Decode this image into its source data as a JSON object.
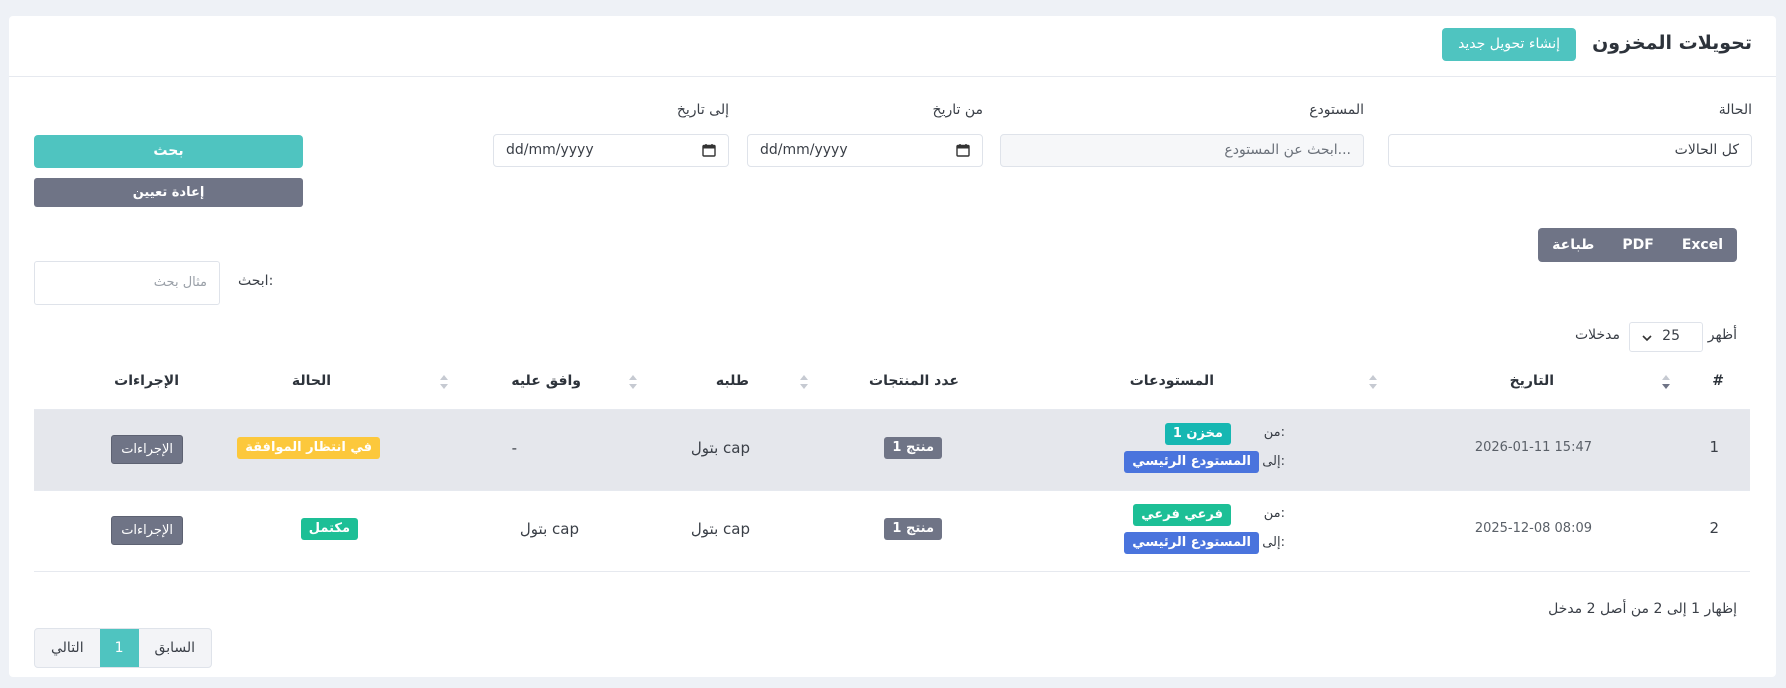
{
  "header": {
    "title": "تحويلات المخزون",
    "new_button": "إنشاء تحويل جديد"
  },
  "filters": {
    "status_label": "الحالة",
    "status_value": "كل الحالات",
    "warehouse_label": "المستودع",
    "warehouse_placeholder": "ابحث عن المستودع...",
    "from_date_label": "من تاريخ",
    "from_date_value": "dd/mm/yyyy",
    "to_date_label": "إلى تاريخ",
    "to_date_value": "dd/mm/yyyy",
    "search_button": "بحث",
    "reset_button": "إعادة تعيين"
  },
  "export": {
    "excel": "Excel",
    "pdf": "PDF",
    "print": "طباعة"
  },
  "table_search": {
    "label": "ابحث:",
    "placeholder": "مثال بحث"
  },
  "length": {
    "show": "أظهر",
    "value": "25",
    "entries": "مدخلات"
  },
  "table": {
    "columns": {
      "num": "#",
      "date": "التاريخ",
      "warehouses": "المستودعات",
      "products": "عدد المنتجات",
      "requested": "طلبه",
      "approved": "وافق عليه",
      "status": "الحالة",
      "actions": "الإجراءات"
    },
    "from_prefix": "من:",
    "to_prefix": "إلى:",
    "rows": [
      {
        "num": "1",
        "date": "2026-01-11 15:47",
        "from": "مخزن 1",
        "to": "المستودع الرئيسي",
        "products": "1 منتج",
        "requested": "بتول cap",
        "approved": "-",
        "status": "في انتظار الموافقة",
        "actions": "الإجراءات"
      },
      {
        "num": "2",
        "date": "2025-12-08 08:09",
        "from": "فرعي فرعي",
        "to": "المستودع الرئيسي",
        "products": "1 منتج",
        "requested": "بتول cap",
        "approved": "بتول cap",
        "status": "مكتمل",
        "actions": "الإجراءات"
      }
    ]
  },
  "footer": {
    "info": "إظهار 1 إلى 2 من أصل 2 مدخل",
    "prev": "السابق",
    "page": "1",
    "next": "التالي"
  },
  "colors": {
    "accent": "#4fc4c0",
    "gray_button": "#6f7486",
    "teal_badge": "#16b7b2",
    "green_badge": "#1dbf96",
    "blue_badge": "#4a74dd",
    "yellow_badge": "#fcc83c"
  }
}
